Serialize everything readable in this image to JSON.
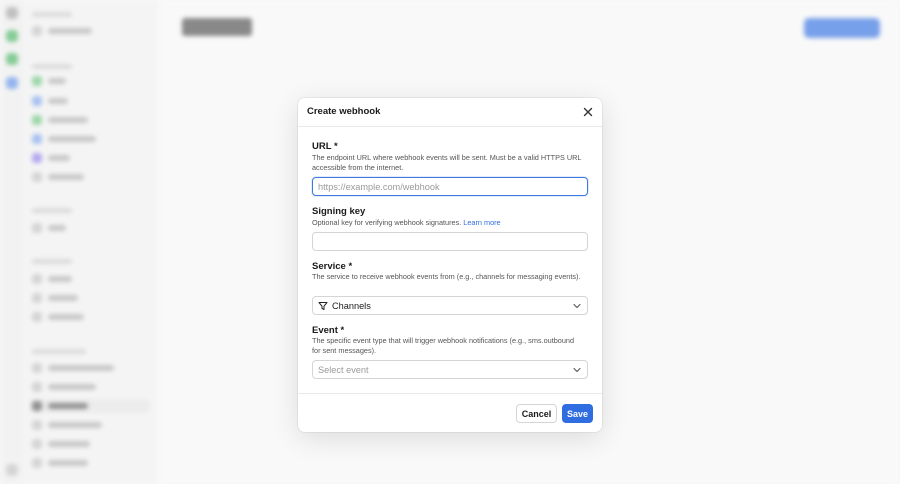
{
  "modal": {
    "title": "Create webhook",
    "close_icon": "close-icon",
    "fields": {
      "url": {
        "label": "URL *",
        "description": "The endpoint URL where webhook events will be sent. Must be a valid HTTPS URL accessible from the internet.",
        "value": "",
        "placeholder": "https://example.com/webhook"
      },
      "signing_key": {
        "label": "Signing key",
        "description": "Optional key for verifying webhook signatures.",
        "link": "Learn more",
        "value": "",
        "placeholder": ""
      },
      "service": {
        "label": "Service *",
        "description": "The service to receive webhook events from (e.g., channels for messaging events).",
        "selected": "Channels",
        "selected_icon": "filter-icon"
      },
      "event": {
        "label": "Event *",
        "description": "The specific event type that will trigger webhook notifications (e.g., sms.outbound for sent messages).",
        "placeholder": "Select event"
      }
    },
    "buttons": {
      "cancel": "Cancel",
      "save": "Save"
    }
  },
  "colors": {
    "primary": "#2f6de0",
    "focus_border": "#3f78e0"
  }
}
